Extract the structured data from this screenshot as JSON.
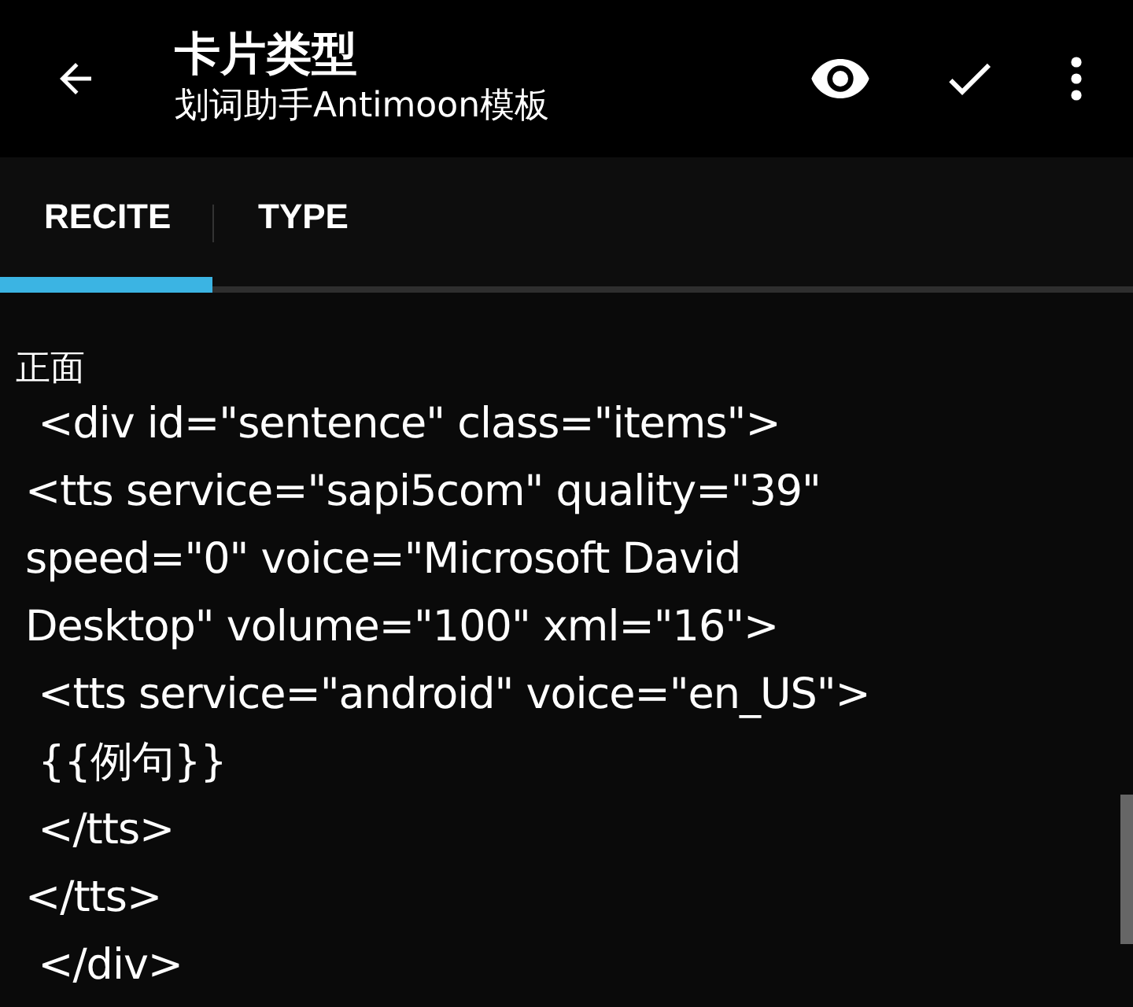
{
  "app_bar": {
    "title": "卡片类型",
    "subtitle": "划词助手Antimoon模板"
  },
  "tabs": [
    {
      "label": "RECITE",
      "selected": true
    },
    {
      "label": "TYPE",
      "selected": false
    }
  ],
  "section_label": "正面",
  "code_lines": [
    " <div id=\"sentence\" class=\"items\">",
    "<tts service=\"sapi5com\" quality=\"39\"",
    "speed=\"0\" voice=\"Microsoft David",
    "Desktop\" volume=\"100\" xml=\"16\">",
    " <tts service=\"android\" voice=\"en_US\">",
    " {{例句}}",
    " </tts>",
    "</tts>",
    " </div>"
  ]
}
